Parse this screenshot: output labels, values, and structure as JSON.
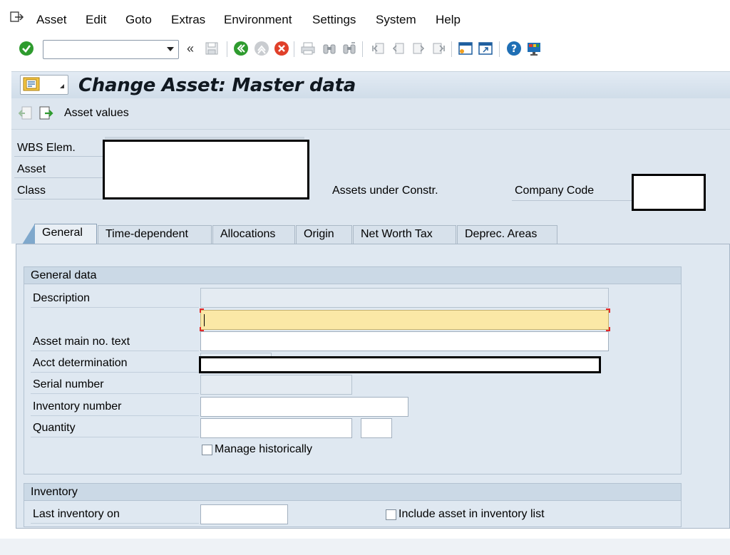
{
  "menu": {
    "items": [
      "Asset",
      "Edit",
      "Goto",
      "Extras",
      "Environment",
      "Settings",
      "System",
      "Help"
    ]
  },
  "toolbar": {
    "command_value": "",
    "icons": [
      "enter-icon",
      "back-icon",
      "exit-icon",
      "cancel-icon",
      "save-icon",
      "print-icon",
      "find-icon",
      "find-next-icon",
      "first-page-icon",
      "previous-page-icon",
      "next-page-icon",
      "last-page-icon",
      "create-session-icon",
      "shortcut-icon",
      "help-icon",
      "customize-layout-icon"
    ]
  },
  "title": {
    "text": "Change Asset:  Master data"
  },
  "application_toolbar": {
    "asset_values_label": "Asset values"
  },
  "header": {
    "wbs_label": "WBS Elem.",
    "asset_label": "Asset",
    "class_label": "Class",
    "auc_label": "Assets under Constr.",
    "company_code_label": "Company Code"
  },
  "tabs": [
    "General",
    "Time-dependent",
    "Allocations",
    "Origin",
    "Net Worth Tax",
    "Deprec. Areas"
  ],
  "general_data": {
    "title": "General data",
    "description_label": "Description",
    "description_1": "",
    "description_2": "",
    "asset_main_text_label": "Asset main no. text",
    "asset_main_text": "",
    "acct_determination_label": "Acct determination",
    "serial_number_label": "Serial number",
    "serial_number": "",
    "inventory_number_label": "Inventory number",
    "inventory_number": "",
    "quantity_label": "Quantity",
    "quantity": "",
    "unit": "",
    "manage_historically_label": "Manage historically",
    "manage_historically": false
  },
  "inventory": {
    "title": "Inventory",
    "last_inventory_label": "Last inventory on",
    "last_inventory": "",
    "include_label": "Include asset in inventory list",
    "include": false
  },
  "colors": {
    "background": "#dfe8f1",
    "title_bar": "#d0dde9",
    "focus_field": "#fbe8a6",
    "enter_green": "#2e9b2e",
    "cancel_red": "#e0402a"
  }
}
